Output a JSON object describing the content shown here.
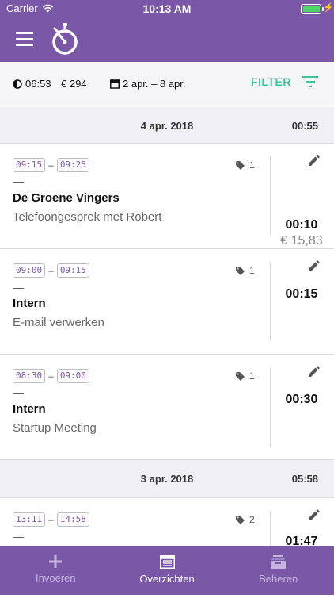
{
  "status_bar": {
    "carrier": "Carrier",
    "time": "10:13 AM"
  },
  "summary": {
    "duration": "06:53",
    "amount": "€ 294",
    "date_range": "2 apr. – 8 apr.",
    "filter_label": "FILTER"
  },
  "days": [
    {
      "date": "4 apr. 2018",
      "total": "00:55",
      "entries": [
        {
          "start": "09:15",
          "end": "09:25",
          "dash": "—",
          "client": "De Groene Vingers",
          "description": "Telefoongesprek met Robert",
          "tag_count": "1",
          "duration": "00:10",
          "amount": "€ 15,83"
        },
        {
          "start": "09:00",
          "end": "09:15",
          "dash": "—",
          "client": "Intern",
          "description": "E-mail verwerken",
          "tag_count": "1",
          "duration": "00:15",
          "amount": ""
        },
        {
          "start": "08:30",
          "end": "09:00",
          "dash": "—",
          "client": "Intern",
          "description": "Startup Meeting",
          "tag_count": "1",
          "duration": "00:30",
          "amount": ""
        }
      ]
    },
    {
      "date": "3 apr. 2018",
      "total": "05:58",
      "entries": [
        {
          "start": "13:11",
          "end": "14:58",
          "dash": "—",
          "client": "",
          "description": "",
          "tag_count": "2",
          "duration": "01:47",
          "amount": ""
        }
      ]
    }
  ],
  "tabs": [
    {
      "label": "Invoeren",
      "icon": "plus-icon"
    },
    {
      "label": "Overzichten",
      "icon": "list-icon"
    },
    {
      "label": "Beheren",
      "icon": "stack-icon"
    }
  ],
  "colors": {
    "primary": "#7b57a8",
    "accent": "#3dc59a",
    "time_text": "#7b57a8"
  }
}
